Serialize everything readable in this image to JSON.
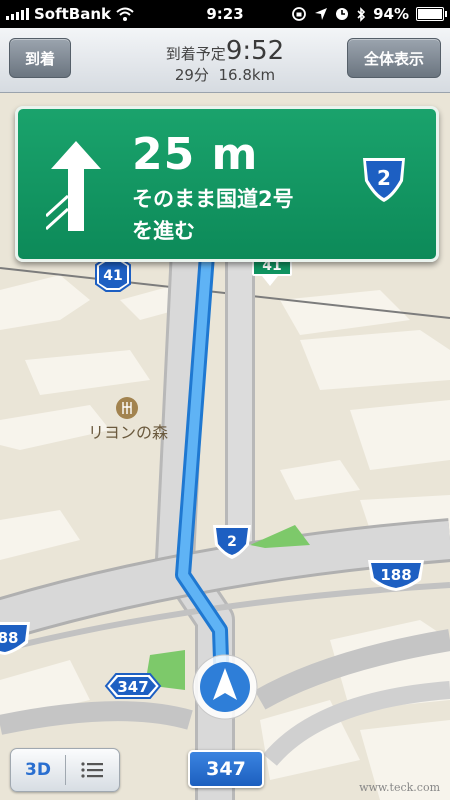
{
  "status": {
    "carrier": "SoftBank",
    "time": "9:23",
    "battery": "94%",
    "battery_level": 0.94,
    "icons": [
      "signal-icon",
      "wifi-icon",
      "rotation-lock-icon",
      "location-icon",
      "alarm-icon",
      "bluetooth-icon",
      "battery-icon"
    ]
  },
  "nav": {
    "end_label": "到着",
    "eta_label": "到着予定",
    "eta_time": "9:52",
    "duration": "29分",
    "distance": "16.8km",
    "overview_label": "全体表示"
  },
  "sign": {
    "distance": "25 m",
    "instruction_line1": "そのまま国道2号",
    "instruction_line2": "を進む",
    "route_number": "2",
    "arrow_icon": "straight-arrow-icon"
  },
  "map": {
    "poi_name": "リヨンの森",
    "poi_icon": "restaurant-icon",
    "route_shields": {
      "r41_left": "41",
      "r41_green": "41",
      "r2": "2",
      "r188": "188",
      "r188_edge": "88",
      "r347": "347"
    },
    "colors": {
      "route": "#3a98e8",
      "sign_green": "#0f9360",
      "shield_blue": "#1d5fc2"
    }
  },
  "controls": {
    "three_d_label": "3D",
    "list_icon": "list-icon",
    "current_road": "347",
    "compass_icon": "navigation-arrow-icon"
  },
  "watermark": "www.teck.com"
}
